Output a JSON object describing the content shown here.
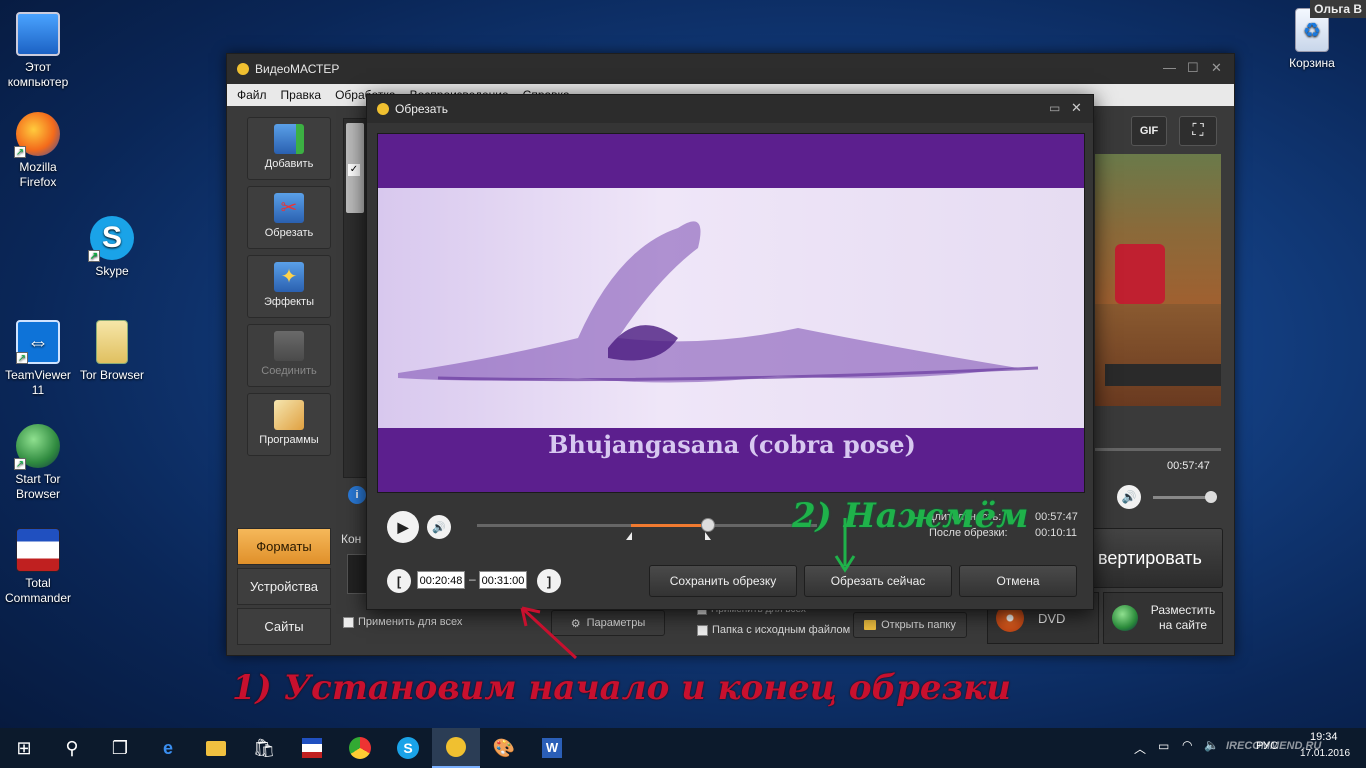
{
  "desktop": {
    "user_label": "Ольга В",
    "icons": [
      {
        "label": "Этот компьютер",
        "icon": "computer-icon"
      },
      {
        "label": "Mozilla Firefox",
        "icon": "firefox-icon"
      },
      {
        "label": "Skype",
        "icon": "skype-icon"
      },
      {
        "label": "TeamViewer 11",
        "icon": "teamviewer-icon"
      },
      {
        "label": "Tor Browser",
        "icon": "tor-browser-icon"
      },
      {
        "label": "Start Tor Browser",
        "icon": "globe-icon"
      },
      {
        "label": "Total Commander",
        "icon": "total-commander-icon"
      },
      {
        "label": "Корзина",
        "icon": "recycle-bin-icon"
      }
    ]
  },
  "main_window": {
    "title": "ВидеоМАСТЕР",
    "menu": [
      "Файл",
      "Правка",
      "Обработка",
      "Воспроизведение",
      "Справка"
    ],
    "sidebar": [
      "Добавить",
      "Обрезать",
      "Эффекты",
      "Соединить",
      "Программы"
    ],
    "tabs": [
      "Форматы",
      "Устройства",
      "Сайты"
    ],
    "conv_partial": "Кон",
    "apply_all": "Применить для всех",
    "apply_all_2": "Применить для всех",
    "source_folder": "Папка с исходным файлом",
    "params": "Параметры",
    "open_folder": "Открыть папку",
    "convert": "вертировать",
    "dvd": "DVD",
    "post_site": "Разместить на сайте",
    "preview_time": "00:57:47",
    "gif": "GIF"
  },
  "dialog": {
    "title": "Обрезать",
    "video_caption": "Bhujangasana (cobra pose)",
    "duration_label": "Длительность:",
    "duration_value": "00:57:47",
    "after_label": "После обрезки:",
    "after_value": "00:10:11",
    "start_time": "00:20:48",
    "dash": "–",
    "end_time": "00:31:00",
    "bracket_left": "[",
    "bracket_right": "]",
    "save_btn": "Сохранить обрезку",
    "cut_btn": "Обрезать сейчас",
    "cancel_btn": "Отмена",
    "slider_progress": 0.44
  },
  "annotations": {
    "step1": "1) Установим начало и конец обрезки",
    "step2": "2) Нажмём"
  },
  "taskbar": {
    "time": "19:34",
    "date": "17.01.2016",
    "lang": "РУС",
    "watermark": "IRECOMMEND.RU"
  },
  "colors": {
    "accent": "#f0a040",
    "annotation_red": "#c8102e",
    "annotation_green": "#1fb24a",
    "video_purple": "#5b1f8c"
  }
}
